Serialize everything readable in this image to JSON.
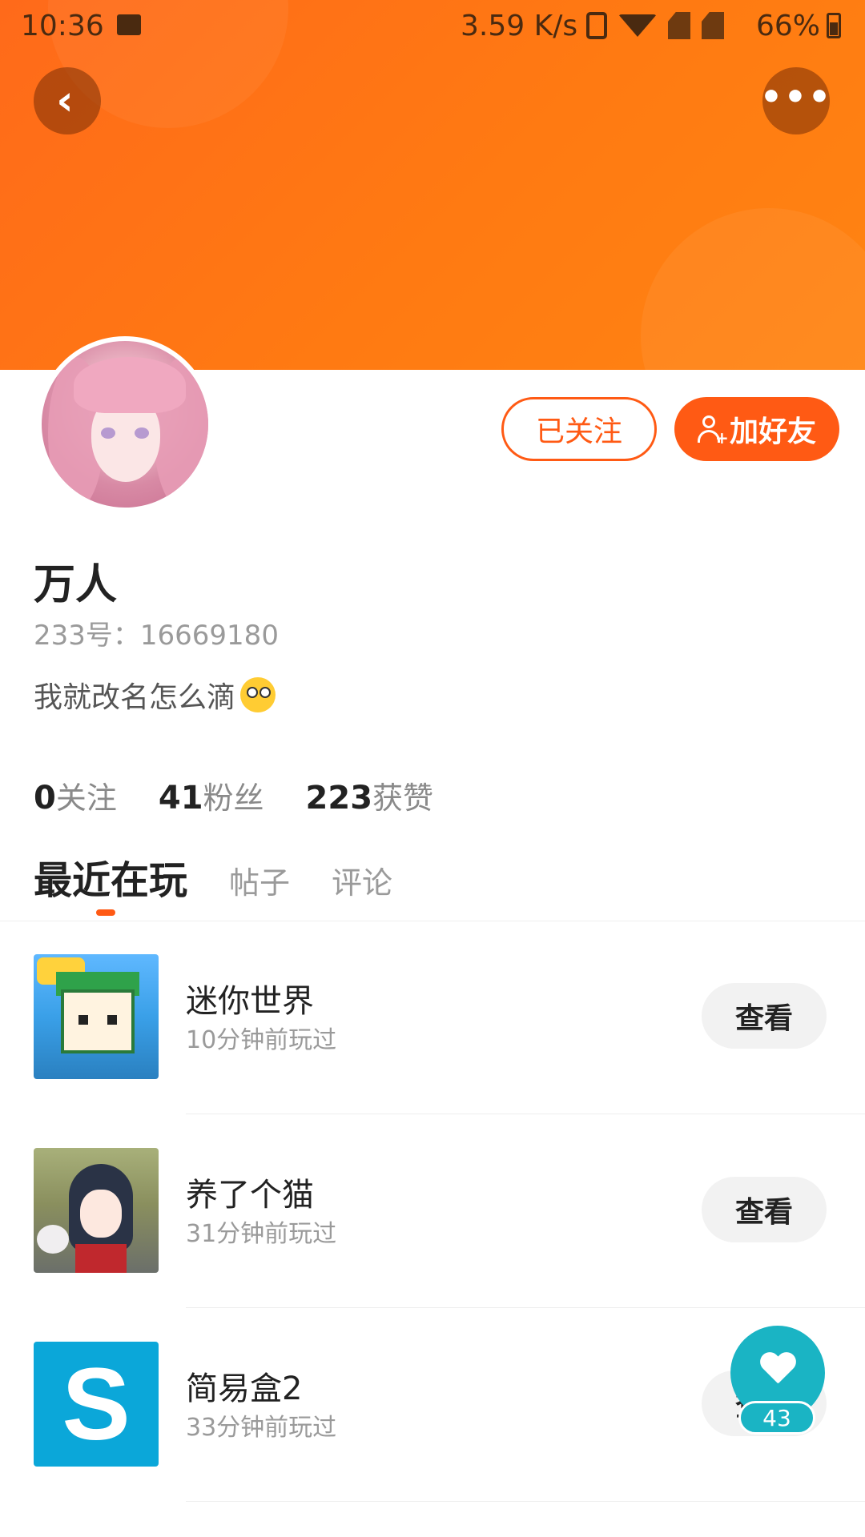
{
  "status_bar": {
    "time": "10:36",
    "network_speed": "3.59 K/s",
    "battery": "66%"
  },
  "header": {
    "back_icon": "chevron-left-icon",
    "more_icon": "more-dots-icon",
    "more_label": "•••",
    "back_label": "‹",
    "gradient_color": "#ff6a1a"
  },
  "profile": {
    "username": "万人",
    "user_id": "233号：16669180",
    "bio": "我就改名怎么滴",
    "followed_label": "已关注",
    "add_friend_label": "加好友"
  },
  "stats": [
    {
      "count": "0",
      "label": "关注"
    },
    {
      "count": "41",
      "label": "粉丝"
    },
    {
      "count": "223",
      "label": "获赞"
    }
  ],
  "tabs": [
    {
      "label": "最近在玩",
      "active": true
    },
    {
      "label": "帖子",
      "active": false
    },
    {
      "label": "评论",
      "active": false
    }
  ],
  "games": [
    {
      "name": "迷你世界",
      "time": "10分钟前玩过",
      "action": "查看",
      "icon": "mini-world-icon"
    },
    {
      "name": "养了个猫",
      "time": "31分钟前玩过",
      "action": "查看",
      "icon": "cat-game-icon"
    },
    {
      "name": "简易盒2",
      "time": "33分钟前玩过",
      "action": "查看",
      "icon": "s-box-icon",
      "icon_letter": "S"
    }
  ],
  "like_button": {
    "count": "43",
    "icon": "heart-icon",
    "color": "#1ab4c4"
  },
  "accent_color": "#ff5a14"
}
